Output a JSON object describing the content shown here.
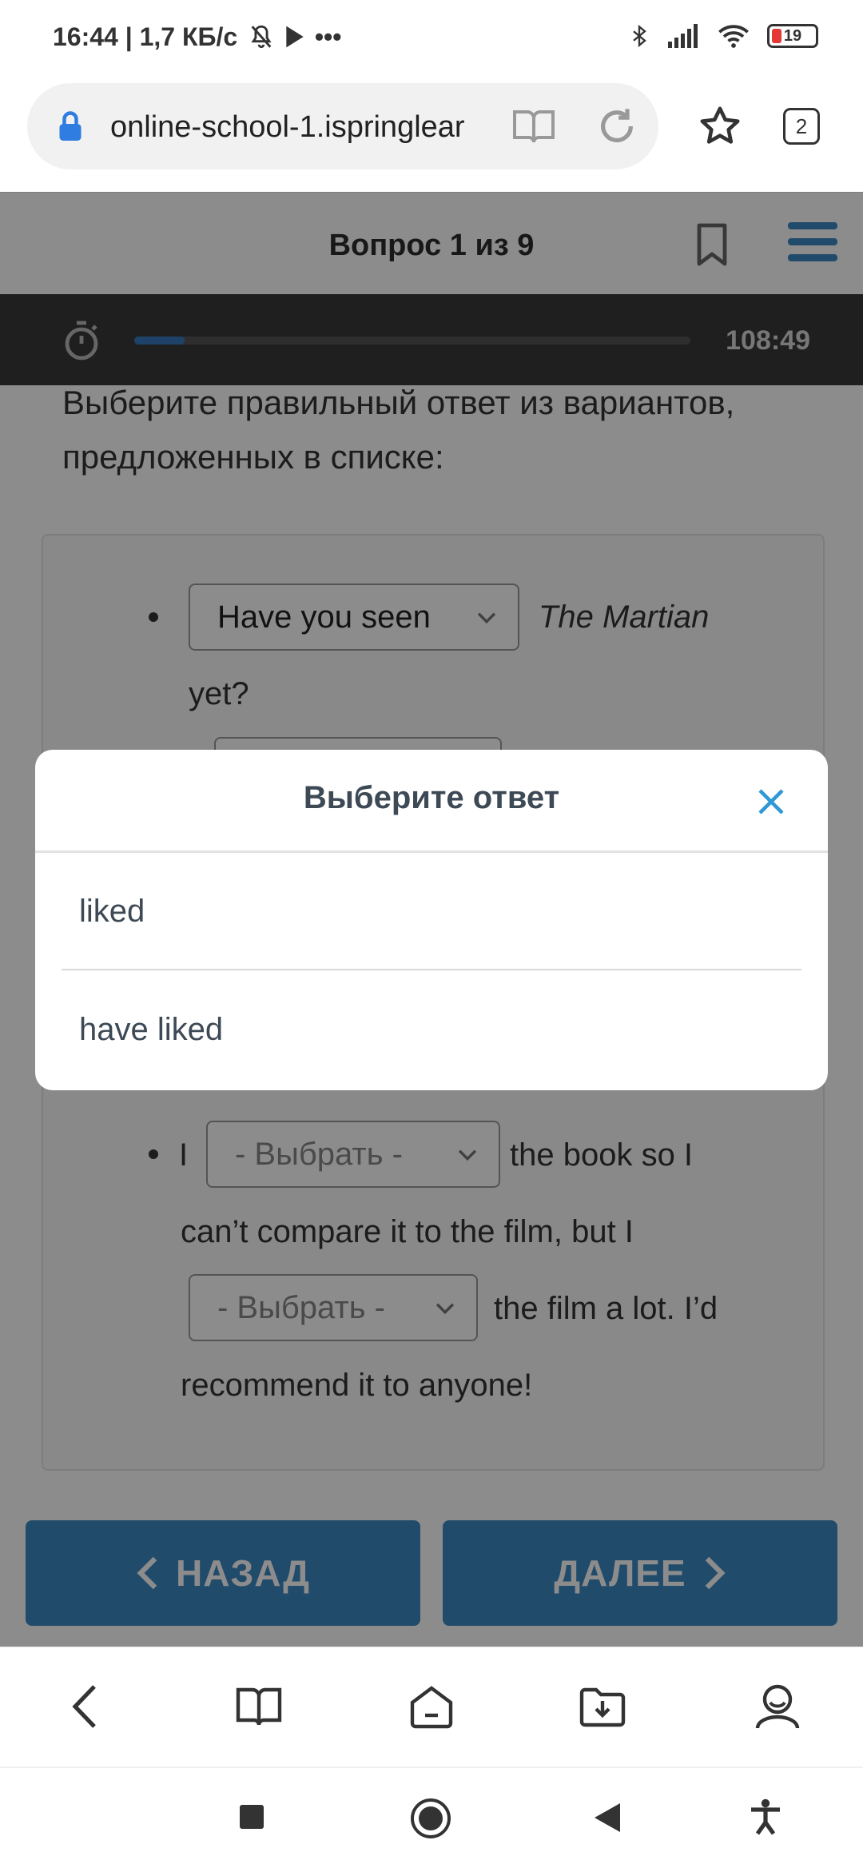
{
  "status_bar": {
    "time_and_speed": "16:44 | 1,7 КБ/с",
    "battery_level": "19"
  },
  "browser": {
    "url": "online-school-1.ispringlear",
    "tab_count": "2"
  },
  "quiz": {
    "question_counter": "Вопрос 1 из 9",
    "timer": "108:49",
    "progress": 0.09,
    "instruction": "Выберите правильный ответ из вариантов, предложенных в списке:",
    "item1": {
      "selected": "Have you seen",
      "movie_title": "The Martian",
      "trailing": "yet?"
    },
    "item_last": {
      "start": "I",
      "placeholder1": "- Выбрать -",
      "after_select1": "the book so I",
      "line2": "can’t compare it to the film, but I",
      "placeholder2": "- Выбрать -",
      "after_select2": "the film a lot. I’d",
      "line4": "recommend it to anyone!"
    },
    "back_button": "НАЗАД",
    "next_button": "ДАЛЕЕ"
  },
  "modal": {
    "title": "Выберите ответ",
    "options": [
      "liked",
      "have liked"
    ]
  },
  "colors": {
    "accent": "#3d89c4",
    "close_icon": "#2f98d6",
    "timer_bar": "#3a3a3a"
  }
}
